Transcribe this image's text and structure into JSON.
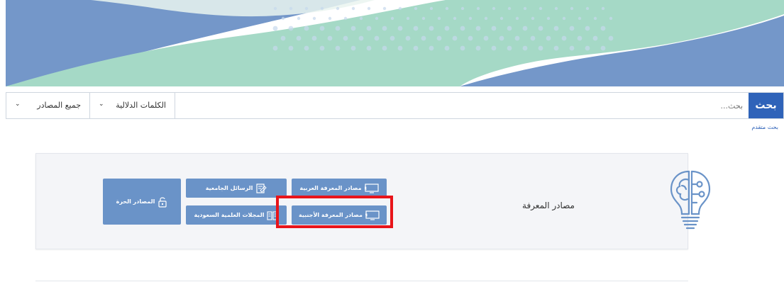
{
  "colors": {
    "primary": "#2f63b9",
    "button": "#6a93c8",
    "hero_blue": "#7497c9",
    "hero_mint": "#a5d9c6",
    "highlight": "#e8141a"
  },
  "search": {
    "button_label": "بحث",
    "placeholder": "بحث...",
    "keywords_select": "الكلمات الدلالية",
    "sources_select": "جميع المصادر",
    "advanced_link": "بحث متقدم"
  },
  "knowledge": {
    "title": "مصادر المعرفة",
    "icon": "lightbulb-brain-icon",
    "buttons": [
      {
        "label": "مصادر المعرفة العربية",
        "icon": "monitor-ar-icon"
      },
      {
        "label": "مصادر المعرفة الأجنبية",
        "icon": "monitor-en-icon"
      },
      {
        "label": "الرسائل الجامعية",
        "icon": "document-edit-icon"
      },
      {
        "label": "المجلات العلمية السعودية",
        "icon": "journal-icon"
      },
      {
        "label": "المصادر الحرة",
        "icon": "unlock-icon"
      }
    ]
  }
}
